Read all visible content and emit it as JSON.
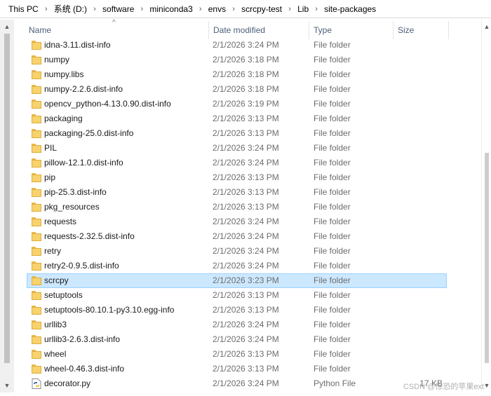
{
  "breadcrumb": [
    "This PC",
    "系统 (D:)",
    "software",
    "miniconda3",
    "envs",
    "scrcpy-test",
    "Lib",
    "site-packages"
  ],
  "columns": {
    "name": "Name",
    "date": "Date modified",
    "type": "Type",
    "size": "Size"
  },
  "rows": [
    {
      "icon": "folder-icon",
      "name": "idna-3.11.dist-info",
      "date": "2/1/2026 3:24 PM",
      "type": "File folder",
      "size": ""
    },
    {
      "icon": "folder-icon",
      "name": "numpy",
      "date": "2/1/2026 3:18 PM",
      "type": "File folder",
      "size": ""
    },
    {
      "icon": "folder-icon",
      "name": "numpy.libs",
      "date": "2/1/2026 3:18 PM",
      "type": "File folder",
      "size": ""
    },
    {
      "icon": "folder-icon",
      "name": "numpy-2.2.6.dist-info",
      "date": "2/1/2026 3:18 PM",
      "type": "File folder",
      "size": ""
    },
    {
      "icon": "folder-icon",
      "name": "opencv_python-4.13.0.90.dist-info",
      "date": "2/1/2026 3:19 PM",
      "type": "File folder",
      "size": ""
    },
    {
      "icon": "folder-icon",
      "name": "packaging",
      "date": "2/1/2026 3:13 PM",
      "type": "File folder",
      "size": ""
    },
    {
      "icon": "folder-icon",
      "name": "packaging-25.0.dist-info",
      "date": "2/1/2026 3:13 PM",
      "type": "File folder",
      "size": ""
    },
    {
      "icon": "folder-icon",
      "name": "PIL",
      "date": "2/1/2026 3:24 PM",
      "type": "File folder",
      "size": ""
    },
    {
      "icon": "folder-icon",
      "name": "pillow-12.1.0.dist-info",
      "date": "2/1/2026 3:24 PM",
      "type": "File folder",
      "size": ""
    },
    {
      "icon": "folder-icon",
      "name": "pip",
      "date": "2/1/2026 3:13 PM",
      "type": "File folder",
      "size": ""
    },
    {
      "icon": "folder-icon",
      "name": "pip-25.3.dist-info",
      "date": "2/1/2026 3:13 PM",
      "type": "File folder",
      "size": ""
    },
    {
      "icon": "folder-icon",
      "name": "pkg_resources",
      "date": "2/1/2026 3:13 PM",
      "type": "File folder",
      "size": ""
    },
    {
      "icon": "folder-icon",
      "name": "requests",
      "date": "2/1/2026 3:24 PM",
      "type": "File folder",
      "size": ""
    },
    {
      "icon": "folder-icon",
      "name": "requests-2.32.5.dist-info",
      "date": "2/1/2026 3:24 PM",
      "type": "File folder",
      "size": ""
    },
    {
      "icon": "folder-icon",
      "name": "retry",
      "date": "2/1/2026 3:24 PM",
      "type": "File folder",
      "size": ""
    },
    {
      "icon": "folder-icon",
      "name": "retry2-0.9.5.dist-info",
      "date": "2/1/2026 3:24 PM",
      "type": "File folder",
      "size": ""
    },
    {
      "icon": "folder-icon",
      "name": "scrcpy",
      "date": "2/1/2026 3:23 PM",
      "type": "File folder",
      "size": "",
      "selected": true
    },
    {
      "icon": "folder-icon",
      "name": "setuptools",
      "date": "2/1/2026 3:13 PM",
      "type": "File folder",
      "size": ""
    },
    {
      "icon": "folder-icon",
      "name": "setuptools-80.10.1-py3.10.egg-info",
      "date": "2/1/2026 3:13 PM",
      "type": "File folder",
      "size": ""
    },
    {
      "icon": "folder-icon",
      "name": "urllib3",
      "date": "2/1/2026 3:24 PM",
      "type": "File folder",
      "size": ""
    },
    {
      "icon": "folder-icon",
      "name": "urllib3-2.6.3.dist-info",
      "date": "2/1/2026 3:24 PM",
      "type": "File folder",
      "size": ""
    },
    {
      "icon": "folder-icon",
      "name": "wheel",
      "date": "2/1/2026 3:13 PM",
      "type": "File folder",
      "size": ""
    },
    {
      "icon": "folder-icon",
      "name": "wheel-0.46.3.dist-info",
      "date": "2/1/2026 3:13 PM",
      "type": "File folder",
      "size": ""
    },
    {
      "icon": "python-file-icon",
      "name": "decorator.py",
      "date": "2/1/2026 3:24 PM",
      "type": "Python File",
      "size": "17 KB"
    }
  ],
  "watermark": "CSDN @惊恐的苹果ext"
}
